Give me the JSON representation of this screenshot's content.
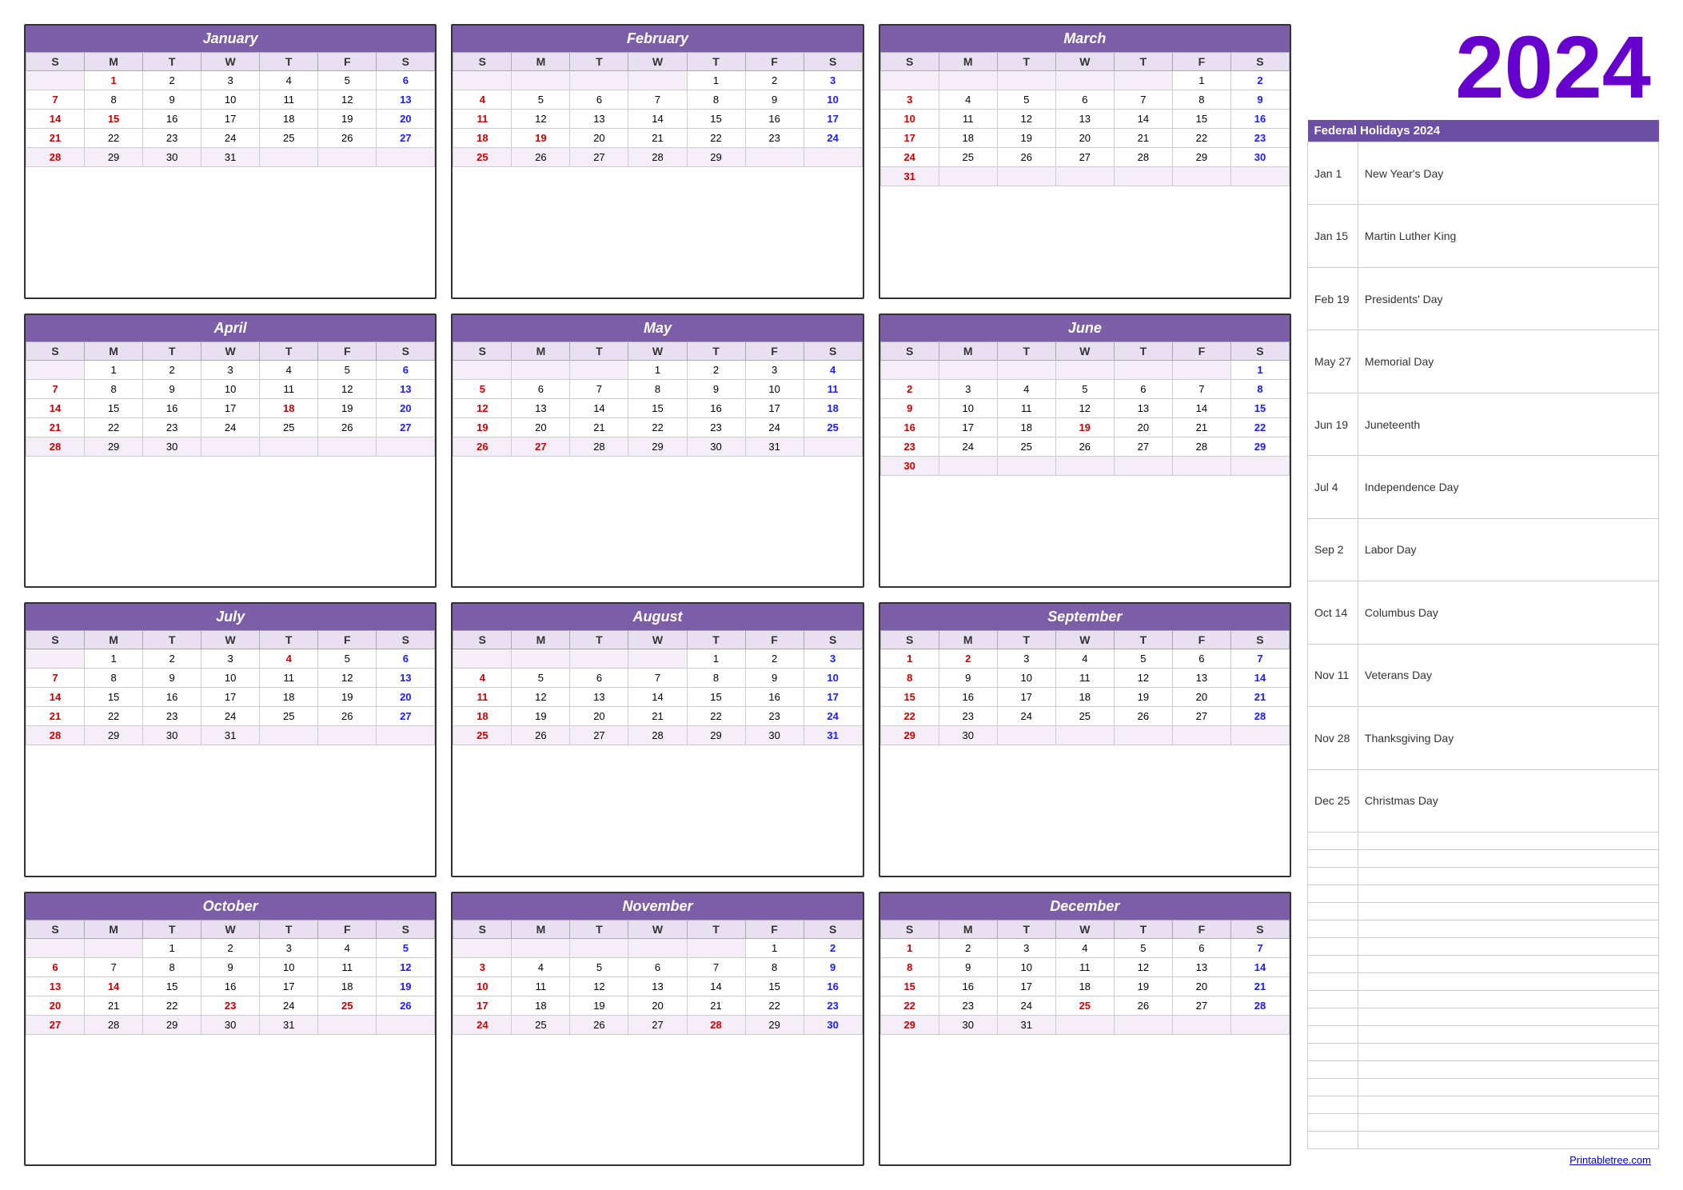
{
  "year": "2024",
  "months": [
    {
      "name": "January",
      "startDay": 1,
      "days": 31,
      "weeks": [
        [
          "",
          "1",
          "2",
          "3",
          "4",
          "5",
          "6"
        ],
        [
          "7",
          "8",
          "9",
          "10",
          "11",
          "12",
          "13"
        ],
        [
          "14",
          "15",
          "16",
          "17",
          "18",
          "19",
          "20"
        ],
        [
          "21",
          "22",
          "23",
          "24",
          "25",
          "26",
          "27"
        ],
        [
          "28",
          "29",
          "30",
          "31",
          "",
          "",
          ""
        ]
      ],
      "colorMap": {
        "1": "red",
        "6": "blue",
        "7": "red",
        "13": "blue",
        "14": "red",
        "15": "red",
        "20": "blue",
        "21": "red",
        "27": "blue",
        "28": "red"
      }
    },
    {
      "name": "February",
      "startDay": 4,
      "days": 29,
      "weeks": [
        [
          "",
          "",
          "",
          "",
          "1",
          "2",
          "3"
        ],
        [
          "4",
          "5",
          "6",
          "7",
          "8",
          "9",
          "10"
        ],
        [
          "11",
          "12",
          "13",
          "14",
          "15",
          "16",
          "17"
        ],
        [
          "18",
          "19",
          "20",
          "21",
          "22",
          "23",
          "24"
        ],
        [
          "25",
          "26",
          "27",
          "28",
          "29",
          "",
          ""
        ]
      ],
      "colorMap": {
        "3": "blue",
        "4": "red",
        "10": "blue",
        "11": "red",
        "17": "blue",
        "18": "red",
        "19": "red",
        "24": "blue",
        "25": "red"
      }
    },
    {
      "name": "March",
      "startDay": 6,
      "days": 31,
      "weeks": [
        [
          "",
          "",
          "",
          "",
          "",
          "1",
          "2"
        ],
        [
          "3",
          "4",
          "5",
          "6",
          "7",
          "8",
          "9"
        ],
        [
          "10",
          "11",
          "12",
          "13",
          "14",
          "15",
          "16"
        ],
        [
          "17",
          "18",
          "19",
          "20",
          "21",
          "22",
          "23"
        ],
        [
          "24",
          "25",
          "26",
          "27",
          "28",
          "29",
          "30"
        ],
        [
          "31",
          "",
          "",
          "",
          "",
          "",
          ""
        ]
      ],
      "colorMap": {
        "2": "blue",
        "3": "red",
        "9": "blue",
        "10": "red",
        "16": "blue",
        "17": "red",
        "23": "blue",
        "24": "red",
        "30": "blue",
        "31": "red"
      }
    },
    {
      "name": "April",
      "startDay": 1,
      "days": 30,
      "weeks": [
        [
          "",
          "1",
          "2",
          "3",
          "4",
          "5",
          "6"
        ],
        [
          "7",
          "8",
          "9",
          "10",
          "11",
          "12",
          "13"
        ],
        [
          "14",
          "15",
          "16",
          "17",
          "18",
          "19",
          "20"
        ],
        [
          "21",
          "22",
          "23",
          "24",
          "25",
          "26",
          "27"
        ],
        [
          "28",
          "29",
          "30",
          "",
          "",
          "",
          ""
        ]
      ],
      "colorMap": {
        "6": "blue",
        "7": "red",
        "13": "blue",
        "14": "red",
        "18": "red",
        "20": "blue",
        "21": "red",
        "27": "blue",
        "28": "red"
      }
    },
    {
      "name": "May",
      "startDay": 3,
      "days": 31,
      "weeks": [
        [
          "",
          "",
          "",
          "1",
          "2",
          "3",
          "4"
        ],
        [
          "5",
          "6",
          "7",
          "8",
          "9",
          "10",
          "11"
        ],
        [
          "12",
          "13",
          "14",
          "15",
          "16",
          "17",
          "18"
        ],
        [
          "19",
          "20",
          "21",
          "22",
          "23",
          "24",
          "25"
        ],
        [
          "26",
          "27",
          "28",
          "29",
          "30",
          "31",
          ""
        ]
      ],
      "colorMap": {
        "4": "blue",
        "5": "red",
        "11": "blue",
        "12": "red",
        "18": "blue",
        "19": "red",
        "25": "blue",
        "26": "red",
        "27": "red"
      }
    },
    {
      "name": "June",
      "startDay": 7,
      "days": 30,
      "weeks": [
        [
          "",
          "",
          "",
          "",
          "",
          "",
          "1"
        ],
        [
          "2",
          "3",
          "4",
          "5",
          "6",
          "7",
          "8"
        ],
        [
          "9",
          "10",
          "11",
          "12",
          "13",
          "14",
          "15"
        ],
        [
          "16",
          "17",
          "18",
          "19",
          "20",
          "21",
          "22"
        ],
        [
          "23",
          "24",
          "25",
          "26",
          "27",
          "28",
          "29"
        ],
        [
          "30",
          "",
          "",
          "",
          "",
          "",
          ""
        ]
      ],
      "colorMap": {
        "1": "blue",
        "2": "red",
        "8": "blue",
        "9": "red",
        "15": "blue",
        "16": "red",
        "19": "red",
        "22": "blue",
        "23": "red",
        "29": "blue",
        "30": "red"
      }
    },
    {
      "name": "July",
      "startDay": 1,
      "days": 31,
      "weeks": [
        [
          "",
          "1",
          "2",
          "3",
          "4",
          "5",
          "6"
        ],
        [
          "7",
          "8",
          "9",
          "10",
          "11",
          "12",
          "13"
        ],
        [
          "14",
          "15",
          "16",
          "17",
          "18",
          "19",
          "20"
        ],
        [
          "21",
          "22",
          "23",
          "24",
          "25",
          "26",
          "27"
        ],
        [
          "28",
          "29",
          "30",
          "31",
          "",
          "",
          ""
        ]
      ],
      "colorMap": {
        "4": "red",
        "6": "blue",
        "7": "red",
        "13": "blue",
        "14": "red",
        "20": "blue",
        "21": "red",
        "27": "blue",
        "28": "red"
      }
    },
    {
      "name": "August",
      "startDay": 4,
      "days": 31,
      "weeks": [
        [
          "",
          "",
          "",
          "",
          "1",
          "2",
          "3"
        ],
        [
          "4",
          "5",
          "6",
          "7",
          "8",
          "9",
          "10"
        ],
        [
          "11",
          "12",
          "13",
          "14",
          "15",
          "16",
          "17"
        ],
        [
          "18",
          "19",
          "20",
          "21",
          "22",
          "23",
          "24"
        ],
        [
          "25",
          "26",
          "27",
          "28",
          "29",
          "30",
          "31"
        ]
      ],
      "colorMap": {
        "3": "blue",
        "4": "red",
        "10": "blue",
        "11": "red",
        "17": "blue",
        "18": "red",
        "24": "blue",
        "25": "red",
        "31": "blue"
      }
    },
    {
      "name": "September",
      "startDay": 0,
      "days": 30,
      "weeks": [
        [
          "1",
          "2",
          "3",
          "4",
          "5",
          "6",
          "7"
        ],
        [
          "8",
          "9",
          "10",
          "11",
          "12",
          "13",
          "14"
        ],
        [
          "15",
          "16",
          "17",
          "18",
          "19",
          "20",
          "21"
        ],
        [
          "22",
          "23",
          "24",
          "25",
          "26",
          "27",
          "28"
        ],
        [
          "29",
          "30",
          "",
          "",
          "",
          "",
          ""
        ]
      ],
      "colorMap": {
        "1": "red",
        "2": "red",
        "7": "blue",
        "8": "red",
        "14": "blue",
        "15": "red",
        "21": "blue",
        "22": "red",
        "28": "blue",
        "29": "red"
      }
    },
    {
      "name": "October",
      "startDay": 2,
      "days": 31,
      "weeks": [
        [
          "",
          "",
          "1",
          "2",
          "3",
          "4",
          "5"
        ],
        [
          "6",
          "7",
          "8",
          "9",
          "10",
          "11",
          "12"
        ],
        [
          "13",
          "14",
          "15",
          "16",
          "17",
          "18",
          "19"
        ],
        [
          "20",
          "21",
          "22",
          "23",
          "24",
          "25",
          "26"
        ],
        [
          "27",
          "28",
          "29",
          "30",
          "31",
          "",
          ""
        ]
      ],
      "colorMap": {
        "5": "blue",
        "6": "red",
        "12": "blue",
        "13": "red",
        "14": "red",
        "19": "blue",
        "20": "red",
        "23": "red",
        "25": "red",
        "26": "blue",
        "27": "red"
      }
    },
    {
      "name": "November",
      "startDay": 6,
      "days": 30,
      "weeks": [
        [
          "",
          "",
          "",
          "",
          "",
          "1",
          "2"
        ],
        [
          "3",
          "4",
          "5",
          "6",
          "7",
          "8",
          "9"
        ],
        [
          "10",
          "11",
          "12",
          "13",
          "14",
          "15",
          "16"
        ],
        [
          "17",
          "18",
          "19",
          "20",
          "21",
          "22",
          "23"
        ],
        [
          "24",
          "25",
          "26",
          "27",
          "28",
          "29",
          "30"
        ]
      ],
      "colorMap": {
        "2": "blue",
        "3": "red",
        "9": "blue",
        "10": "red",
        "16": "blue",
        "17": "red",
        "23": "blue",
        "24": "red",
        "28": "red",
        "30": "blue"
      }
    },
    {
      "name": "December",
      "startDay": 0,
      "days": 31,
      "weeks": [
        [
          "1",
          "2",
          "3",
          "4",
          "5",
          "6",
          "7"
        ],
        [
          "8",
          "9",
          "10",
          "11",
          "12",
          "13",
          "14"
        ],
        [
          "15",
          "16",
          "17",
          "18",
          "19",
          "20",
          "21"
        ],
        [
          "22",
          "23",
          "24",
          "25",
          "26",
          "27",
          "28"
        ],
        [
          "29",
          "30",
          "31",
          "",
          "",
          "",
          ""
        ]
      ],
      "colorMap": {
        "1": "red",
        "7": "blue",
        "8": "red",
        "14": "blue",
        "15": "red",
        "21": "blue",
        "22": "red",
        "25": "red",
        "28": "blue",
        "29": "red"
      }
    }
  ],
  "holidays": {
    "title": "Federal Holidays 2024",
    "list": [
      {
        "date": "Jan 1",
        "name": "New Year's Day"
      },
      {
        "date": "Jan 15",
        "name": "Martin Luther King"
      },
      {
        "date": "Feb 19",
        "name": "Presidents' Day"
      },
      {
        "date": "May 27",
        "name": "Memorial Day"
      },
      {
        "date": "Jun 19",
        "name": "Juneteenth"
      },
      {
        "date": "Jul 4",
        "name": "Independence Day"
      },
      {
        "date": "Sep 2",
        "name": "Labor Day"
      },
      {
        "date": "Oct 14",
        "name": "Columbus Day"
      },
      {
        "date": "Nov 11",
        "name": "Veterans Day"
      },
      {
        "date": "Nov 28",
        "name": "Thanksgiving Day"
      },
      {
        "date": "Dec 25",
        "name": "Christmas Day"
      }
    ]
  },
  "footer_link": "Printabletree.com"
}
